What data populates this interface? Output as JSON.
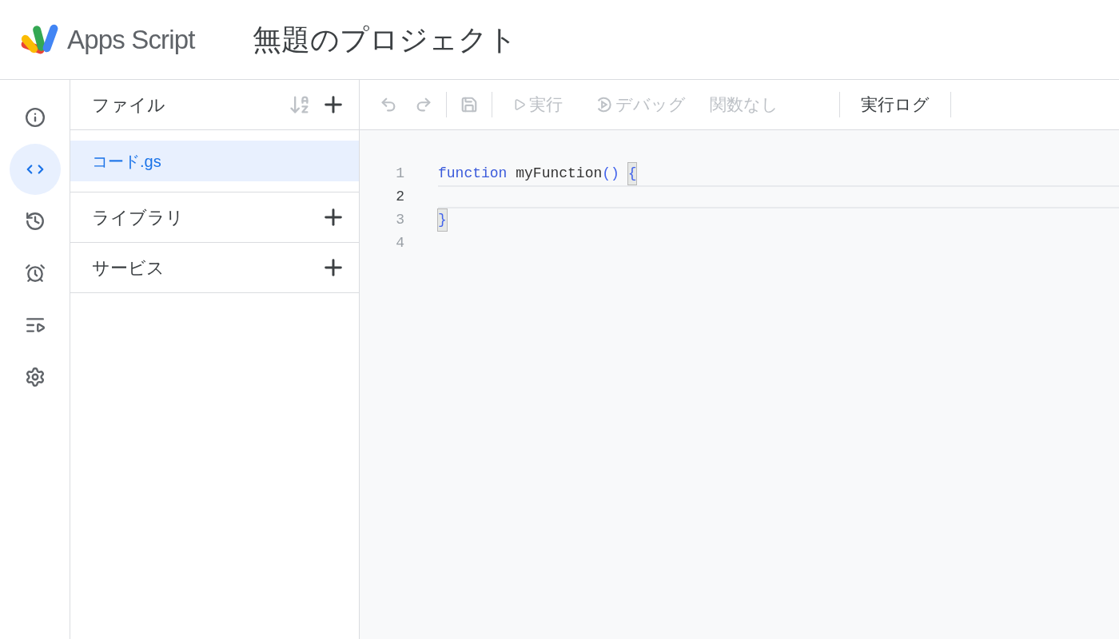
{
  "header": {
    "product": "Apps Script",
    "project_title": "無題のプロジェクト"
  },
  "rail": [
    {
      "kind": "info",
      "selected": false
    },
    {
      "kind": "code",
      "selected": true
    },
    {
      "kind": "history",
      "selected": false
    },
    {
      "kind": "alarm",
      "selected": false
    },
    {
      "kind": "queue",
      "selected": false
    },
    {
      "kind": "settings",
      "selected": false
    }
  ],
  "files_panel": {
    "title": "ファイル",
    "files": [
      {
        "name": "コード.gs",
        "selected": true
      }
    ],
    "sections": [
      {
        "title": "ライブラリ"
      },
      {
        "title": "サービス"
      }
    ]
  },
  "toolbar": [
    {
      "kind": "undo",
      "disabled": true
    },
    {
      "kind": "redo",
      "disabled": true
    },
    {
      "kind": "divider"
    },
    {
      "kind": "save",
      "disabled": true
    },
    {
      "kind": "divider"
    },
    {
      "kind": "run",
      "label": "実行",
      "disabled": true
    },
    {
      "kind": "debug",
      "label": "デバッグ",
      "disabled": true
    },
    {
      "kind": "select",
      "label": "関数なし",
      "disabled": true
    },
    {
      "kind": "divider"
    },
    {
      "kind": "log",
      "label": "実行ログ",
      "disabled": false
    },
    {
      "kind": "divider"
    }
  ],
  "editor": {
    "lines": [
      {
        "number": "1",
        "current": false,
        "tokens": [
          {
            "kind": "keyword",
            "text": "function"
          },
          {
            "kind": "plain",
            "text": " myFunction"
          },
          {
            "kind": "punct",
            "text": "() "
          },
          {
            "kind": "bracket",
            "text": "{"
          }
        ]
      },
      {
        "number": "2",
        "current": true
      },
      {
        "number": "3",
        "current": false,
        "tokens": [
          {
            "kind": "bracket",
            "text": "}"
          }
        ]
      },
      {
        "number": "4",
        "current": false
      }
    ]
  }
}
